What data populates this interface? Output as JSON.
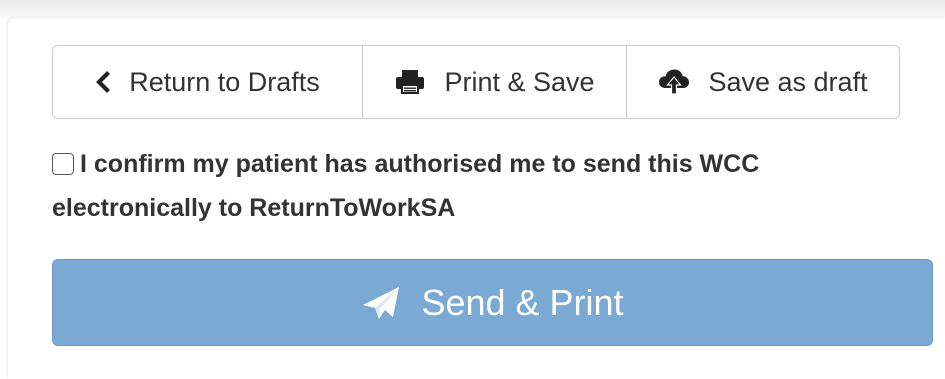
{
  "toolbar": {
    "return_label": "Return to Drafts",
    "print_save_label": "Print & Save",
    "save_draft_label": "Save as draft",
    "icons": {
      "return": "chevron-left-icon",
      "print_save": "print-icon",
      "save_draft": "cloud-upload-icon"
    }
  },
  "confirm": {
    "checked": false,
    "text": "I confirm my patient has authorised me to send this WCC electronically to ReturnToWorkSA"
  },
  "send": {
    "label": "Send & Print",
    "icon": "paper-plane-icon",
    "color": "#7aaad4"
  }
}
